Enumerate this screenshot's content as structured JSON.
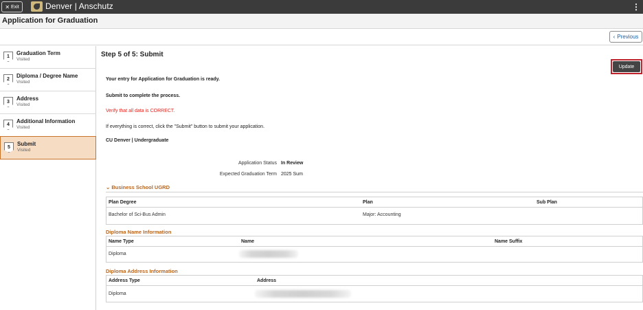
{
  "topbar": {
    "exit_label": "Exit",
    "exit_icon": "close-icon",
    "brand": "Denver | Anschutz",
    "menu_icon": "kebab-icon"
  },
  "title": "Application for Graduation",
  "nav": {
    "previous_label": "Previous"
  },
  "steps": [
    {
      "num": "1",
      "label": "Graduation Term",
      "status": "Visited"
    },
    {
      "num": "2",
      "label": "Diploma / Degree Name",
      "status": "Visited"
    },
    {
      "num": "3",
      "label": "Address",
      "status": "Visited"
    },
    {
      "num": "4",
      "label": "Additional Information",
      "status": "Visited"
    },
    {
      "num": "5",
      "label": "Submit",
      "status": "Visited"
    }
  ],
  "main": {
    "heading": "Step 5 of 5: Submit",
    "update_label": "Update",
    "ready_text": "Your entry for Application for Graduation is ready.",
    "submit_text": "Submit to complete the process.",
    "verify_text": "Verify that all data is CORRECT.",
    "instruction_text": "If everything is correct, click the \"Submit\" button to submit your application.",
    "institution": "CU Denver | Undergraduate",
    "status_label": "Application Status",
    "status_value": "In Review",
    "term_label": "Expected Graduation Term",
    "term_value": "2025 Sum"
  },
  "business_section": {
    "title": "Business School UGRD",
    "headers": [
      "Plan Degree",
      "Plan",
      "Sub Plan"
    ],
    "row": [
      "Bachelor of Sci-Bus Admin",
      "Major: Accounting",
      ""
    ]
  },
  "diploma_name": {
    "title": "Diploma Name Information",
    "headers": [
      "Name Type",
      "Name",
      "Name Suffix"
    ],
    "row": [
      "Diploma",
      "",
      ""
    ]
  },
  "diploma_address": {
    "title": "Diploma Address Information",
    "headers": [
      "Address Type",
      "Address"
    ],
    "row": [
      "Diploma",
      ""
    ]
  },
  "colors": {
    "accent": "#b8651f",
    "active_step_bg": "#f7dcc4",
    "alert_red": "#e4241d",
    "topbar": "#3b3b3b"
  }
}
